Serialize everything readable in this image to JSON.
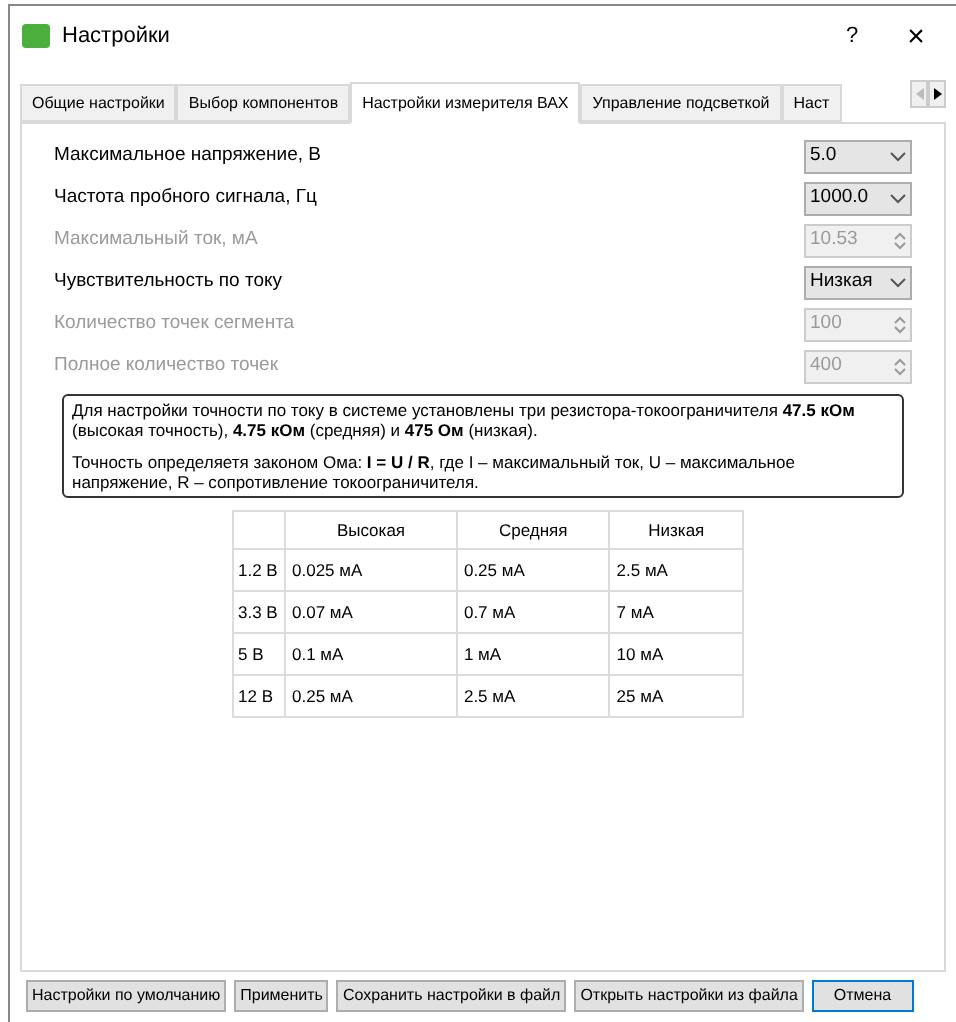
{
  "window": {
    "title": "Настройки",
    "help": "?",
    "close": "×"
  },
  "tabs": [
    {
      "label": "Общие настройки",
      "selected": false
    },
    {
      "label": "Выбор компонентов",
      "selected": false
    },
    {
      "label": "Настройки измерителя ВАХ",
      "selected": true
    },
    {
      "label": "Управление подсветкой",
      "selected": false
    },
    {
      "label": "Наст",
      "selected": false
    }
  ],
  "fields": [
    {
      "label": "Максимальное напряжение, В",
      "kind": "combo",
      "value": "5.0",
      "disabled": false
    },
    {
      "label": "Частота пробного сигнала, Гц",
      "kind": "combo",
      "value": "1000.0",
      "disabled": false
    },
    {
      "label": "Максимальный ток, мА",
      "kind": "spin",
      "value": "10.53",
      "disabled": true
    },
    {
      "label": "Чувствительность по току",
      "kind": "combo",
      "value": "Низкая",
      "disabled": false
    },
    {
      "label": "Количество точек сегмента",
      "kind": "spin",
      "value": "100",
      "disabled": true
    },
    {
      "label": "Полное количество точек",
      "kind": "spin",
      "value": "400",
      "disabled": true
    }
  ],
  "info": [
    "Для настройки точности по току в системе установлены три резистора-токоограничителя **47.5 кОм** (высокая точность), **4.75 кОм** (средняя) и **475 Ом** (низкая).",
    "Точность определяетя законом Ома: **I = U / R**, где I – максимальный ток, U – максимальное напряжение, R – сопротивление токоограничителя."
  ],
  "table": {
    "columns": [
      "Высокая",
      "Средняя",
      "Низкая"
    ],
    "rows": [
      {
        "label": "1.2 В",
        "cells": [
          "0.025 мА",
          "0.25 мА",
          "2.5 мА"
        ]
      },
      {
        "label": "3.3 В",
        "cells": [
          "0.07 мА",
          "0.7 мА",
          "7 мА"
        ]
      },
      {
        "label": "5 В",
        "cells": [
          "0.1 мА",
          "1 мА",
          "10 мА"
        ]
      },
      {
        "label": "12 В",
        "cells": [
          "0.25 мА",
          "2.5 мА",
          "25 мА"
        ]
      }
    ]
  },
  "buttons": [
    {
      "label": "Настройки по умолчанию",
      "default": false
    },
    {
      "label": "Применить",
      "default": false
    },
    {
      "label": "Сохранить настройки в файл",
      "default": false
    },
    {
      "label": "Открыть настройки из файла",
      "default": false
    },
    {
      "label": "Отмена",
      "default": true
    }
  ]
}
